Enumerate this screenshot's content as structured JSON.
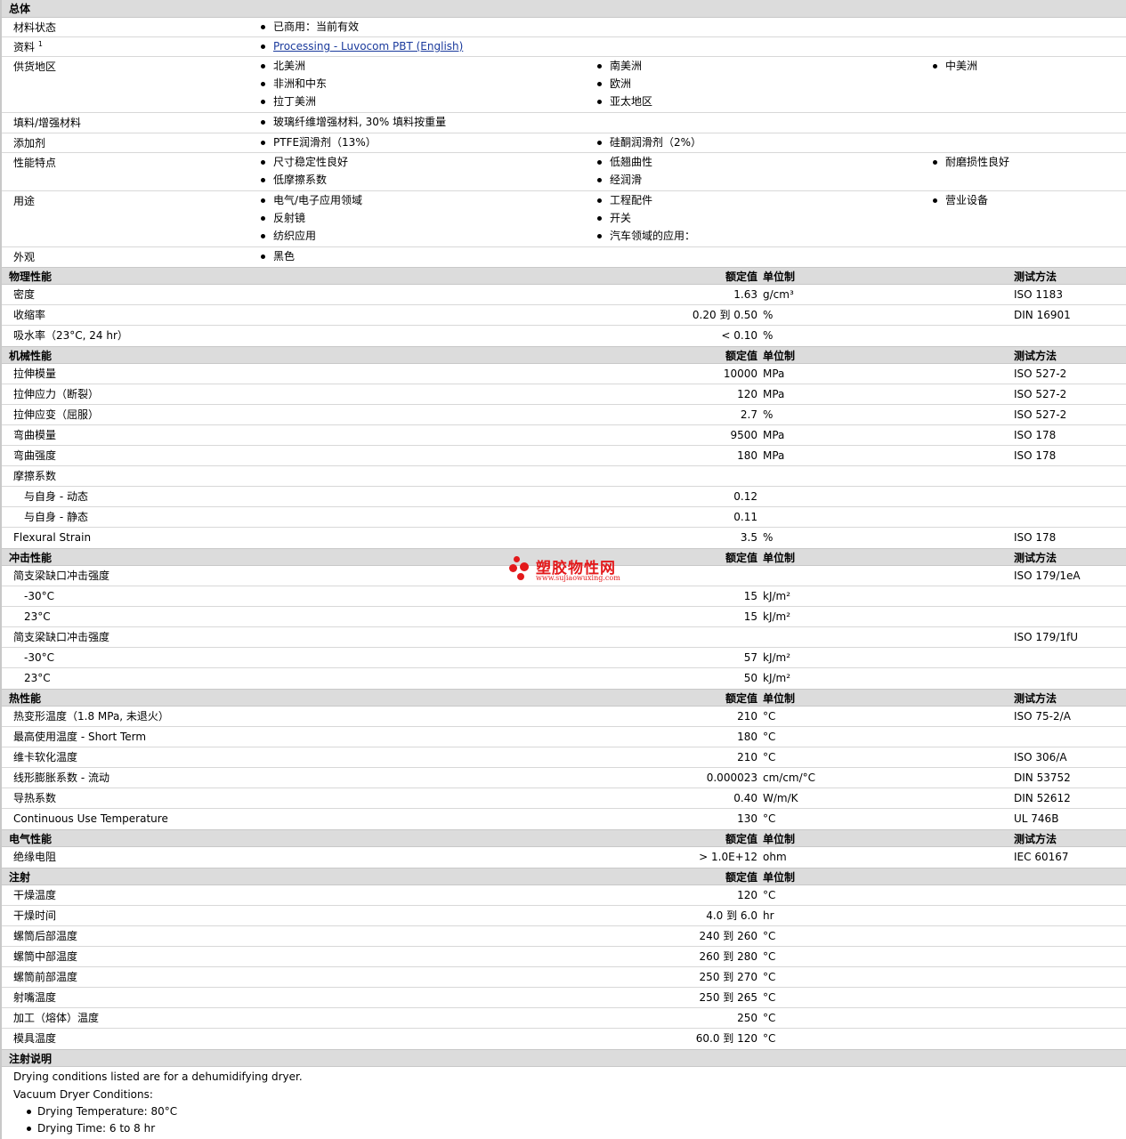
{
  "general": {
    "title": "总体",
    "status_label": "材料状态",
    "status_value": "已商用：当前有效",
    "docs_label": "资料",
    "docs_sup": "1",
    "docs_link": "Processing - Luvocom PBT (English)",
    "supply_label": "供货地区",
    "supply_col1": [
      "北美洲",
      "非洲和中东",
      "拉丁美洲"
    ],
    "supply_col2": [
      "南美洲",
      "欧洲",
      "亚太地区"
    ],
    "supply_col3": [
      "中美洲"
    ],
    "filler_label": "填料/增强材料",
    "filler_value": "玻璃纤维增强材料, 30% 填料按重量",
    "additive_label": "添加剂",
    "additive_col1": [
      "PTFE润滑剂（13%）"
    ],
    "additive_col2": [
      "硅酮润滑剂（2%）"
    ],
    "feature_label": "性能特点",
    "feature_col1": [
      "尺寸稳定性良好",
      "低摩擦系数"
    ],
    "feature_col2": [
      "低翘曲性",
      "经润滑"
    ],
    "feature_col3": [
      "耐磨损性良好"
    ],
    "use_label": "用途",
    "use_col1": [
      "电气/电子应用领域",
      "反射镜",
      "纺织应用"
    ],
    "use_col2": [
      "工程配件",
      "开关",
      "汽车领域的应用："
    ],
    "use_col3": [
      "营业设备"
    ],
    "appearance_label": "外观",
    "appearance_value": "黑色"
  },
  "headers": {
    "value": "额定值",
    "unit": "单位制",
    "method": "测试方法"
  },
  "physical": {
    "title": "物理性能",
    "rows": [
      {
        "label": "密度",
        "value": "1.63",
        "unit": "g/cm³",
        "method": "ISO 1183"
      },
      {
        "label": "收缩率",
        "value": "0.20 到  0.50",
        "unit": "%",
        "method": "DIN 16901"
      },
      {
        "label": "吸水率（23°C, 24 hr）",
        "value": "< 0.10",
        "unit": "%",
        "method": ""
      }
    ]
  },
  "mechanical": {
    "title": "机械性能",
    "rows": [
      {
        "label": "拉伸模量",
        "value": "10000",
        "unit": "MPa",
        "method": "ISO 527-2"
      },
      {
        "label": "拉伸应力（断裂）",
        "value": "120",
        "unit": "MPa",
        "method": "ISO 527-2"
      },
      {
        "label": "拉伸应变（屈服）",
        "value": "2.7",
        "unit": "%",
        "method": "ISO 527-2"
      },
      {
        "label": "弯曲模量",
        "value": "9500",
        "unit": "MPa",
        "method": "ISO 178"
      },
      {
        "label": "弯曲强度",
        "value": "180",
        "unit": "MPa",
        "method": "ISO 178"
      },
      {
        "label": "摩擦系数",
        "value": "",
        "unit": "",
        "method": ""
      },
      {
        "label": "与自身  - 动态",
        "value": "0.12",
        "unit": "",
        "method": ""
      },
      {
        "label": "与自身  - 静态",
        "value": "0.11",
        "unit": "",
        "method": ""
      },
      {
        "label": "Flexural Strain",
        "value": "3.5",
        "unit": "%",
        "method": "ISO 178"
      }
    ]
  },
  "impact": {
    "title": "冲击性能",
    "rows": [
      {
        "label": "简支梁缺口冲击强度",
        "value": "",
        "unit": "",
        "method": "ISO 179/1eA"
      },
      {
        "label": "-30°C",
        "value": "15",
        "unit": "kJ/m²",
        "method": ""
      },
      {
        "label": "23°C",
        "value": "15",
        "unit": "kJ/m²",
        "method": ""
      },
      {
        "label": "简支梁缺口冲击强度",
        "value": "",
        "unit": "",
        "method": "ISO 179/1fU"
      },
      {
        "label": "-30°C",
        "value": "57",
        "unit": "kJ/m²",
        "method": ""
      },
      {
        "label": "23°C",
        "value": "50",
        "unit": "kJ/m²",
        "method": ""
      }
    ]
  },
  "thermal": {
    "title": "热性能",
    "rows": [
      {
        "label": "热变形温度（1.8 MPa, 未退火）",
        "value": "210",
        "unit": "°C",
        "method": "ISO 75-2/A"
      },
      {
        "label": "最高使用温度  - Short Term",
        "value": "180",
        "unit": "°C",
        "method": ""
      },
      {
        "label": "维卡软化温度",
        "value": "210",
        "unit": "°C",
        "method": "ISO 306/A"
      },
      {
        "label": "线形膨胀系数  - 流动",
        "value": "0.000023",
        "unit": "cm/cm/°C",
        "method": "DIN 53752"
      },
      {
        "label": "导热系数",
        "value": "0.40",
        "unit": "W/m/K",
        "method": "DIN 52612"
      },
      {
        "label": "Continuous Use Temperature",
        "value": "130",
        "unit": "°C",
        "method": "UL 746B"
      }
    ]
  },
  "electrical": {
    "title": "电气性能",
    "rows": [
      {
        "label": "绝缘电阻",
        "value": "> 1.0E+12",
        "unit": "ohm",
        "method": "IEC 60167"
      }
    ]
  },
  "injection": {
    "title": "注射",
    "rows": [
      {
        "label": "干燥温度",
        "value": "120",
        "unit": "°C",
        "method": ""
      },
      {
        "label": "干燥时间",
        "value": "4.0 到  6.0",
        "unit": "hr",
        "method": ""
      },
      {
        "label": "螺筒后部温度",
        "value": "240 到  260",
        "unit": "°C",
        "method": ""
      },
      {
        "label": "螺筒中部温度",
        "value": "260 到  280",
        "unit": "°C",
        "method": ""
      },
      {
        "label": "螺筒前部温度",
        "value": "250 到  270",
        "unit": "°C",
        "method": ""
      },
      {
        "label": "射嘴温度",
        "value": "250 到  265",
        "unit": "°C",
        "method": ""
      },
      {
        "label": "加工（熔体）温度",
        "value": "250",
        "unit": "°C",
        "method": ""
      },
      {
        "label": "模具温度",
        "value": "60.0 到  120",
        "unit": "°C",
        "method": ""
      }
    ]
  },
  "notes": {
    "title": "注射说明",
    "line1": "Drying conditions listed are for a dehumidifying dryer.",
    "line2": "Vacuum Dryer Conditions:",
    "bullet1": "Drying Temperature: 80°C",
    "bullet2": "Drying Time: 6 to 8 hr"
  },
  "watermark": {
    "text": "塑胶物性网",
    "url": "www.sujiaowuxing.com",
    "color": "#e3191b"
  }
}
